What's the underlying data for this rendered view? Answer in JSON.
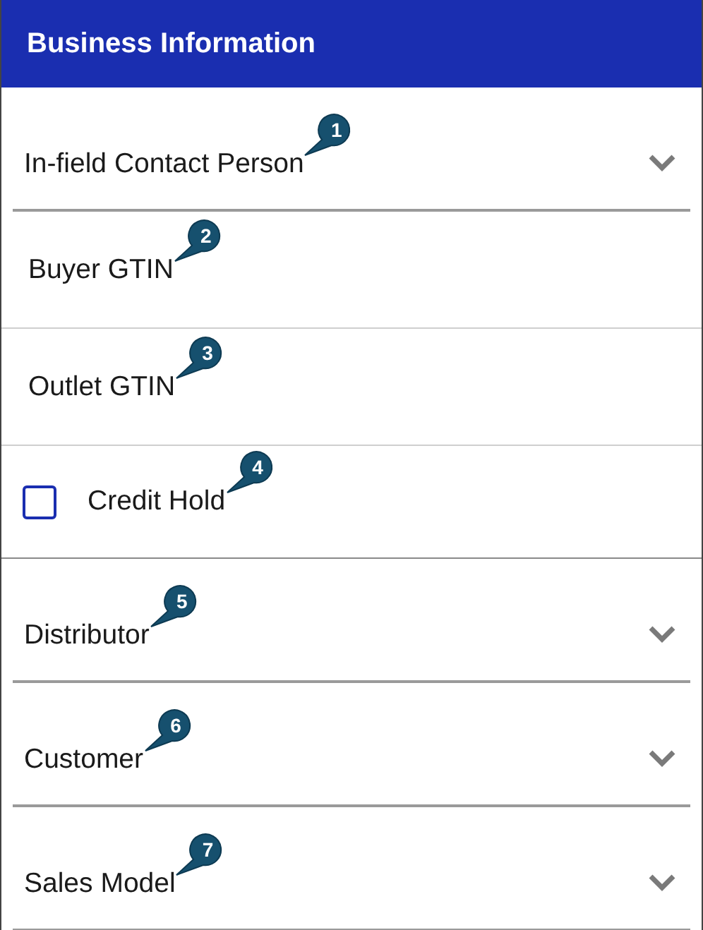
{
  "header": {
    "title": "Business Information"
  },
  "rows": [
    {
      "kind": "dropdown",
      "label": "In-field Contact Person",
      "callout": "1"
    },
    {
      "kind": "field",
      "label": "Buyer GTIN",
      "callout": "2"
    },
    {
      "kind": "field",
      "label": "Outlet GTIN",
      "callout": "3"
    },
    {
      "kind": "checkbox",
      "label": "Credit Hold",
      "checked": false,
      "callout": "4"
    },
    {
      "kind": "dropdown",
      "label": "Distributor",
      "callout": "5"
    },
    {
      "kind": "dropdown",
      "label": "Customer",
      "callout": "6"
    },
    {
      "kind": "dropdown",
      "label": "Sales Model",
      "callout": "7"
    }
  ]
}
